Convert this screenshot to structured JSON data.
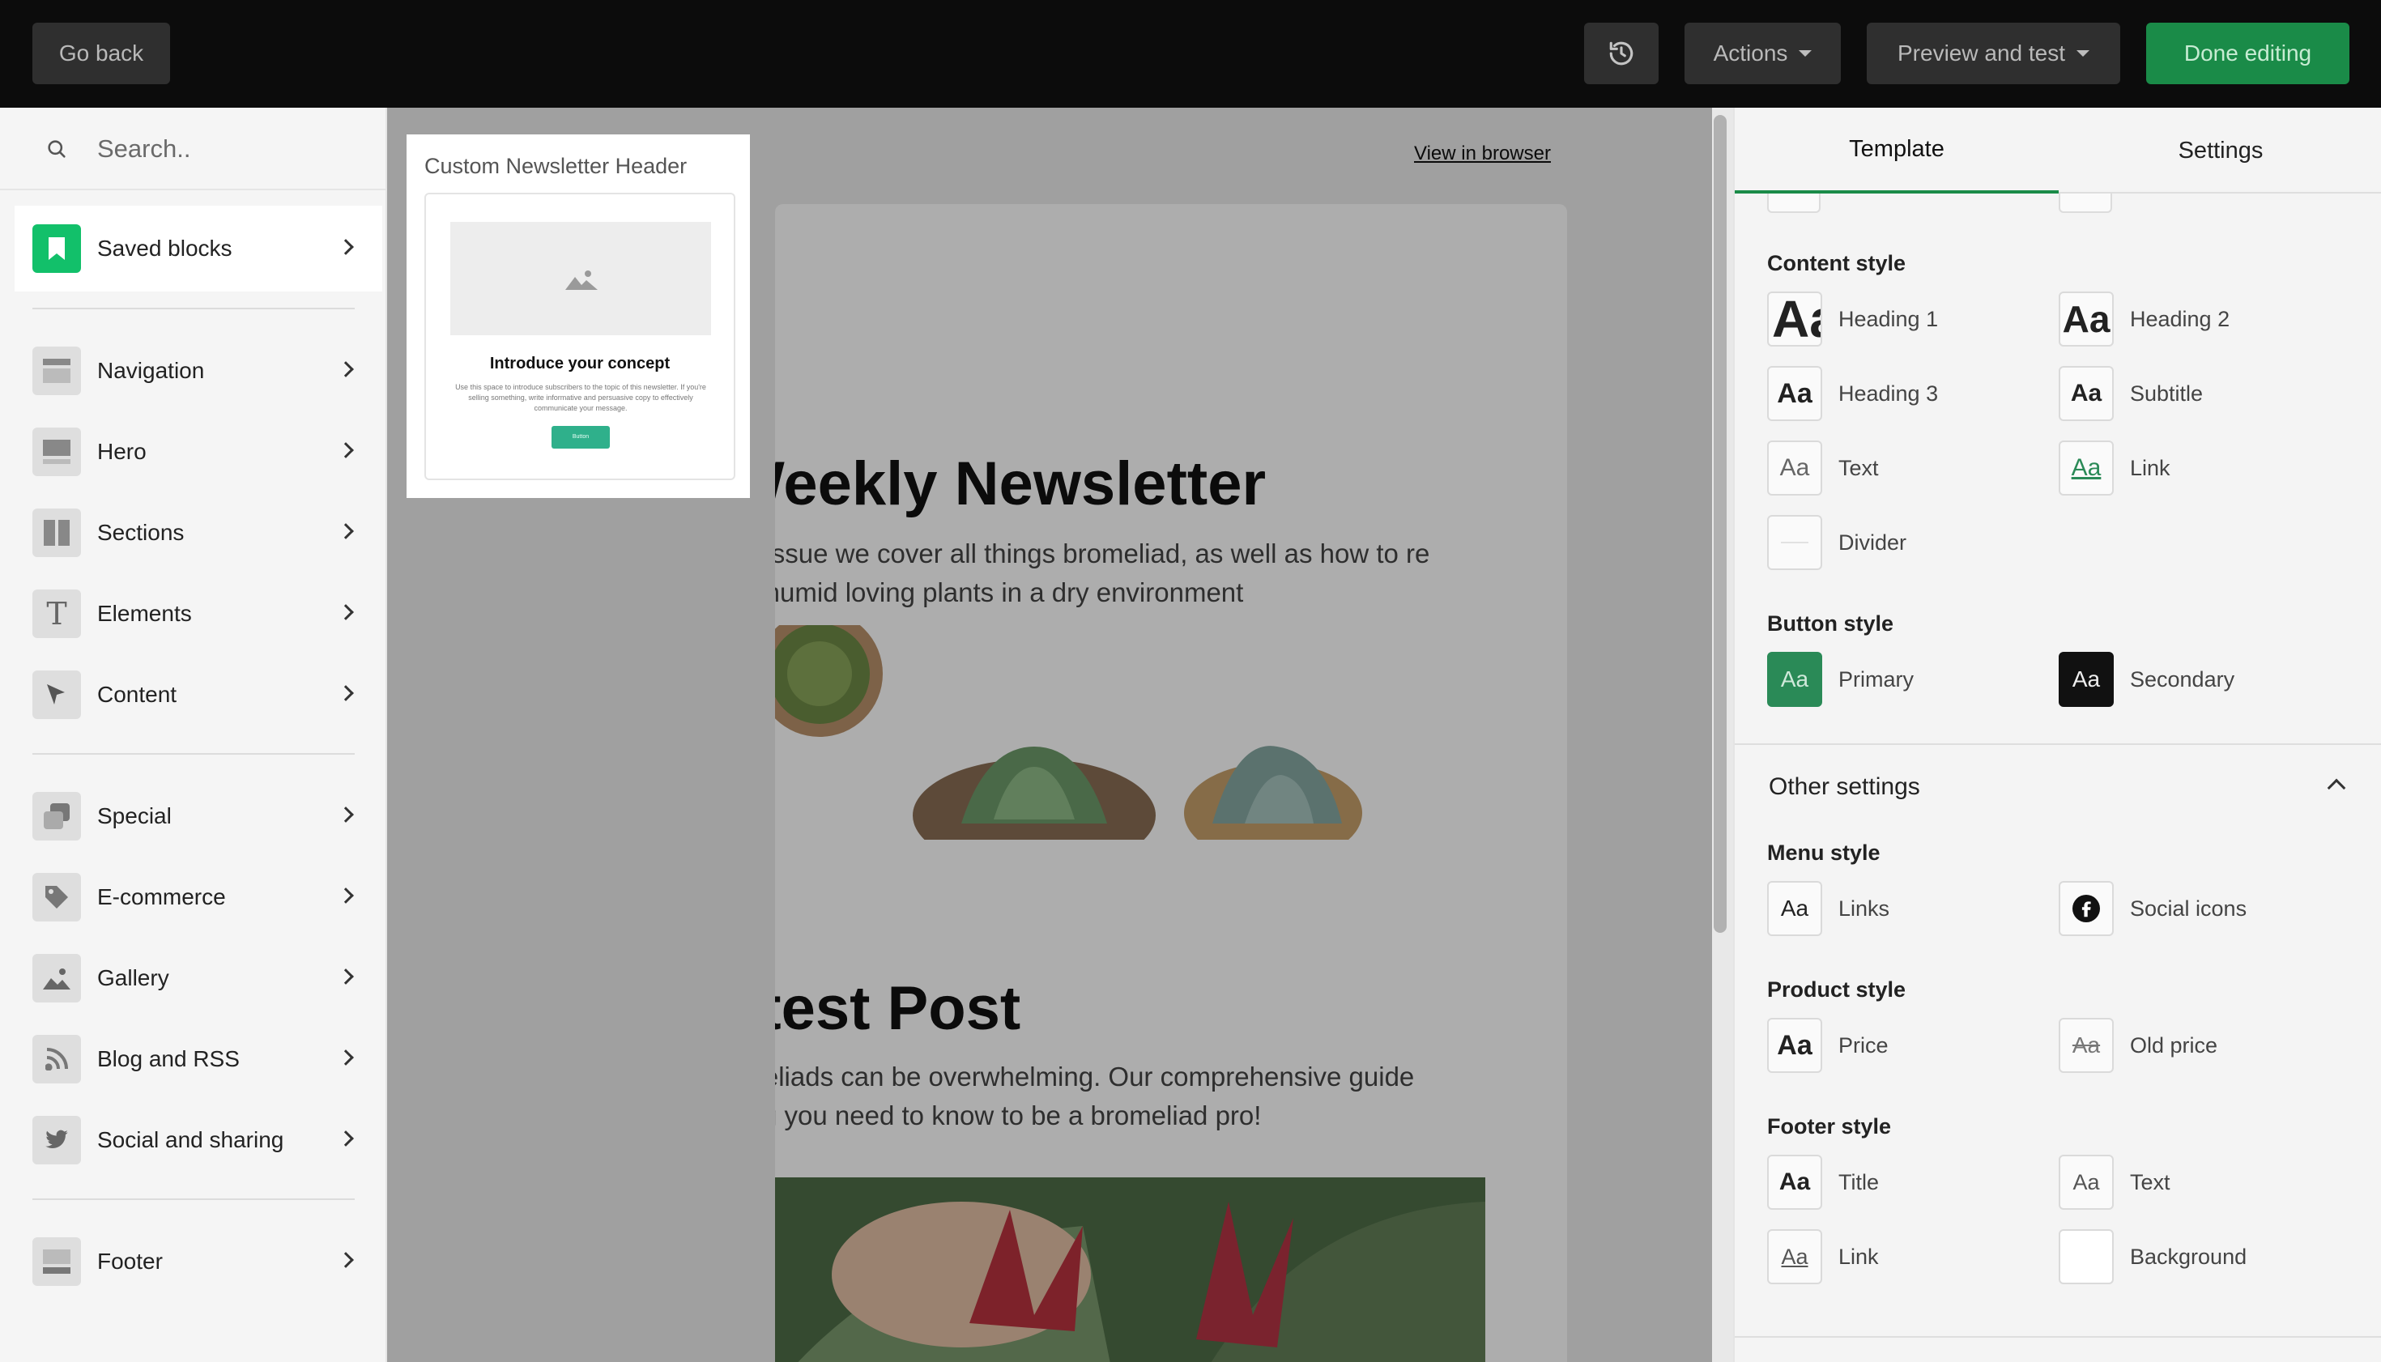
{
  "topbar": {
    "back_label": "Go back",
    "actions_label": "Actions",
    "preview_label": "Preview and test",
    "done_label": "Done editing",
    "history_icon": "history-icon"
  },
  "sidebar": {
    "search_placeholder": "Search..",
    "saved": {
      "label": "Saved blocks",
      "icon": "bookmark-icon"
    },
    "group1": [
      {
        "label": "Navigation",
        "icon": "navigation-icon"
      },
      {
        "label": "Hero",
        "icon": "hero-icon"
      },
      {
        "label": "Sections",
        "icon": "sections-icon"
      },
      {
        "label": "Elements",
        "icon": "text-icon"
      },
      {
        "label": "Content",
        "icon": "cursor-icon"
      }
    ],
    "group2": [
      {
        "label": "Special",
        "icon": "special-icon"
      },
      {
        "label": "E-commerce",
        "icon": "tag-icon"
      },
      {
        "label": "Gallery",
        "icon": "image-icon"
      },
      {
        "label": "Blog and RSS",
        "icon": "rss-icon"
      },
      {
        "label": "Social and sharing",
        "icon": "twitter-icon"
      }
    ],
    "group3": [
      {
        "label": "Footer",
        "icon": "footer-icon"
      }
    ]
  },
  "block_preview": {
    "title": "Custom Newsletter Header",
    "heading": "Introduce your concept",
    "body": "Use this space to introduce subscribers to the topic of this newsletter. If you're selling something, write informative and persuasive copy to effectively communicate your message.",
    "button": "Button"
  },
  "canvas": {
    "view_in_browser": "View in browser",
    "headline": "Weekly Newsletter",
    "intro": "k's issue we cover all things bromeliad, as well as how to re for humid loving plants in a dry environment",
    "latest_title": "atest Post",
    "latest_body": "omeliads can be overwhelming. Our comprehensive guide hing you need to know to be a bromeliad pro!"
  },
  "panel": {
    "tabs": [
      "Template",
      "Settings"
    ],
    "content_style": {
      "title": "Content style",
      "items": [
        {
          "label": "Heading 1",
          "swatch": "Aa"
        },
        {
          "label": "Heading 2",
          "swatch": "Aa"
        },
        {
          "label": "Heading 3",
          "swatch": "Aa"
        },
        {
          "label": "Subtitle",
          "swatch": "Aa"
        },
        {
          "label": "Text",
          "swatch": "Aa"
        },
        {
          "label": "Link",
          "swatch": "Aa"
        },
        {
          "label": "Divider",
          "swatch": ""
        }
      ]
    },
    "button_style": {
      "title": "Button style",
      "items": [
        {
          "label": "Primary",
          "swatch": "Aa",
          "color": "#2a8a57"
        },
        {
          "label": "Secondary",
          "swatch": "Aa",
          "color": "#111111"
        }
      ]
    },
    "other_settings": "Other settings",
    "menu_style": {
      "title": "Menu style",
      "items": [
        {
          "label": "Links",
          "swatch": "Aa"
        },
        {
          "label": "Social icons",
          "icon": "facebook-icon"
        }
      ]
    },
    "product_style": {
      "title": "Product style",
      "items": [
        {
          "label": "Price",
          "swatch": "Aa"
        },
        {
          "label": "Old price",
          "swatch": "Aa"
        }
      ]
    },
    "footer_style": {
      "title": "Footer style",
      "items": [
        {
          "label": "Title",
          "swatch": "Aa"
        },
        {
          "label": "Text",
          "swatch": "Aa"
        },
        {
          "label": "Link",
          "swatch": "Aa"
        },
        {
          "label": "Background",
          "swatch": ""
        }
      ]
    }
  },
  "colors": {
    "accent": "#1a8b48",
    "saved_icon_bg": "#12c06a",
    "topbar_bg": "#0c0c0c"
  }
}
